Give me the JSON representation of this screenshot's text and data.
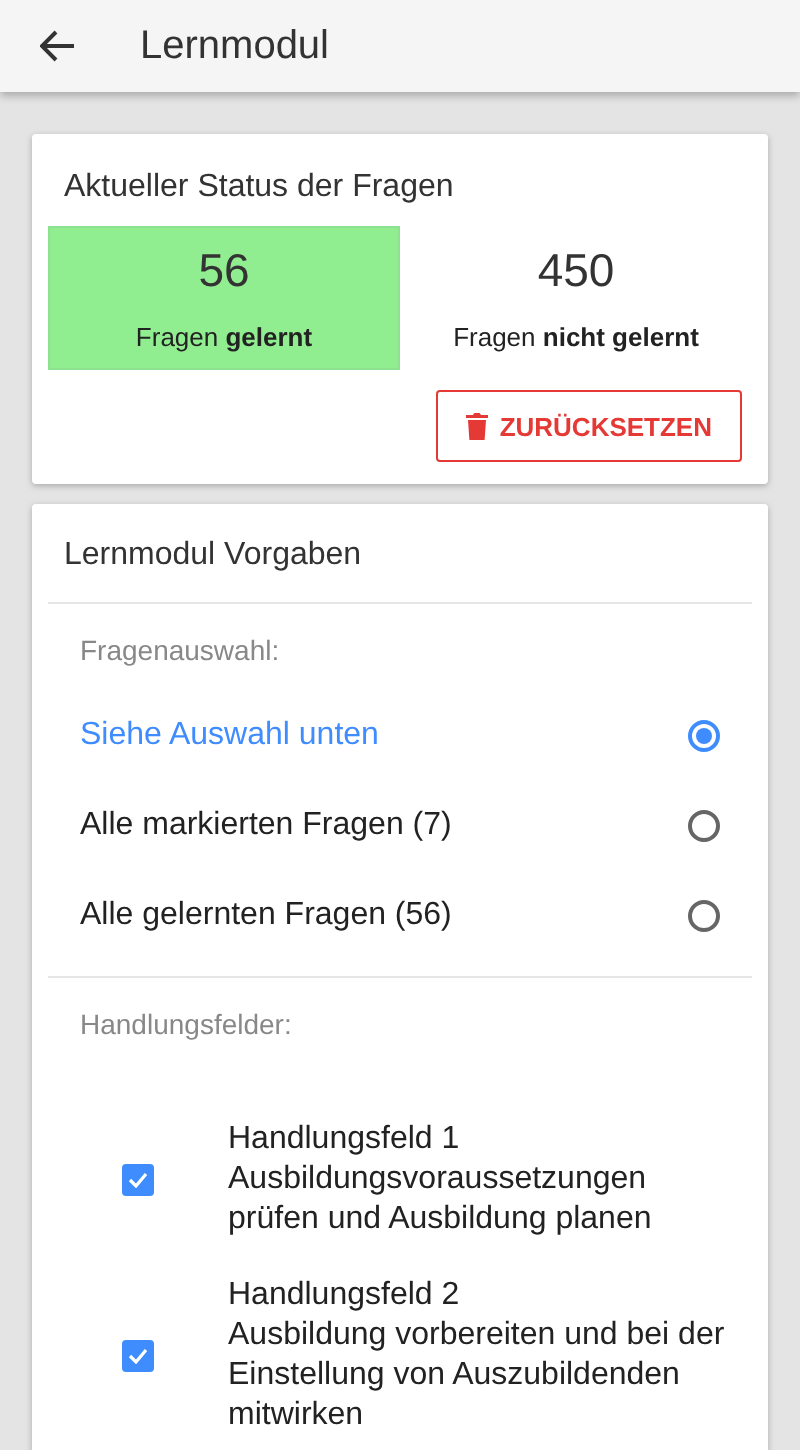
{
  "app_bar": {
    "title": "Lernmodul"
  },
  "status_card": {
    "title": "Aktueller Status der Fragen",
    "stats": [
      {
        "value": "56",
        "label": "Fragen **gelernt**",
        "highlighted": true
      },
      {
        "value": "450",
        "label": "Fragen **nicht gelernt**",
        "highlighted": false
      }
    ],
    "reset_button": "ZURÜCKSETZEN"
  },
  "settings_card": {
    "title": "Lernmodul Vorgaben",
    "selection_label": "Fragenauswahl:",
    "options": [
      {
        "label": "Siehe Auswahl unten",
        "selected": true
      },
      {
        "label": "Alle markierten Fragen (7)",
        "selected": false
      },
      {
        "label": "Alle gelernten Fragen (56)",
        "selected": false
      }
    ],
    "fields_label": "Handlungsfelder:",
    "fields": [
      {
        "title": "Handlungsfeld 1",
        "description": "Ausbildungsvoraussetzungen prüfen und Ausbildung planen",
        "checked": true
      },
      {
        "title": "Handlungsfeld 2",
        "description": "Ausbildung vorbereiten und bei der Einstellung von Auszubildenden mitwirken",
        "checked": true
      }
    ]
  }
}
